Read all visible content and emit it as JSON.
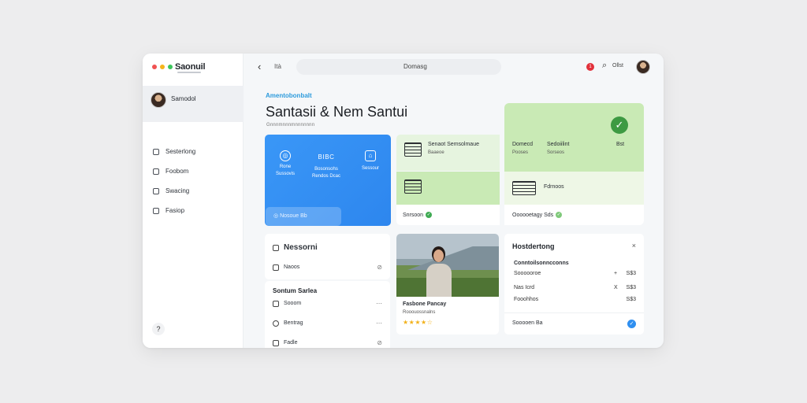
{
  "window": {
    "app_title": "Saonuil",
    "traffic_colors": [
      "#f05252",
      "#f5b41b",
      "#3cc55b"
    ]
  },
  "sidebar": {
    "profile_name": "Samodol",
    "items": [
      {
        "label": "Sesterlong",
        "icon": "grid-icon"
      },
      {
        "label": "Foobom",
        "icon": "doc-icon"
      },
      {
        "label": "Swacing",
        "icon": "chart-icon"
      },
      {
        "label": "Fasiop",
        "icon": "settings-icon"
      }
    ],
    "help_icon": "?"
  },
  "topbar": {
    "back_glyph": "‹",
    "tab_label": "Ità",
    "search_label": "Domasg",
    "notif_count": "1",
    "right_label": "Ollst"
  },
  "heading": {
    "eyebrow": "Amentobonbalt",
    "title": "Santasii & Nem Santui",
    "subtitle": "Gnnnmnnnmnnnnnnn"
  },
  "blue_card": {
    "columns": [
      {
        "head": "",
        "line1": "Rone",
        "line2": "Sussovis"
      },
      {
        "head": "BIBC",
        "line1": "Bosonsohs",
        "line2": "Rendos Dcac"
      },
      {
        "head": "",
        "line1": "Sessour",
        "line2": ""
      }
    ],
    "button_label": "Nosoue Bb"
  },
  "grid": {
    "tile_a_title": "Senaot Semsolmaue",
    "tile_a_sub": "Baaeoe",
    "tile_b_label": "",
    "big_col1_title": "Domecd",
    "big_col1_sub": "Pooses",
    "big_col2_title": "Sedoiilint",
    "big_col2_sub": "Sorseos",
    "big_col3": "Bst",
    "tile_c_label": "Fdrnoos",
    "status_left": "Snrsoon",
    "status_right": "Oooooetagy Sds"
  },
  "card_left": {
    "title": "Nessorni",
    "row1": "Naoos"
  },
  "card_left2": {
    "title": "Sontum Sarlea",
    "rows": [
      "Sooom",
      "Bentrag",
      "Fadle"
    ]
  },
  "photo_card": {
    "name": "Fasbone Pancay",
    "role": "Rooouossnalns",
    "rating": "★★★★☆"
  },
  "history_card": {
    "title": "Hostdertong",
    "subtitle": "Conntoilsonncconns",
    "rows": [
      {
        "label": "Soooooroe",
        "x": "+",
        "value": "S$3"
      },
      {
        "label": "Nas Icrd",
        "x": "X",
        "value": "S$3"
      },
      {
        "label": "Fooohhos",
        "x": "",
        "value": "S$3"
      }
    ],
    "footer": "Sooooen Ba"
  }
}
